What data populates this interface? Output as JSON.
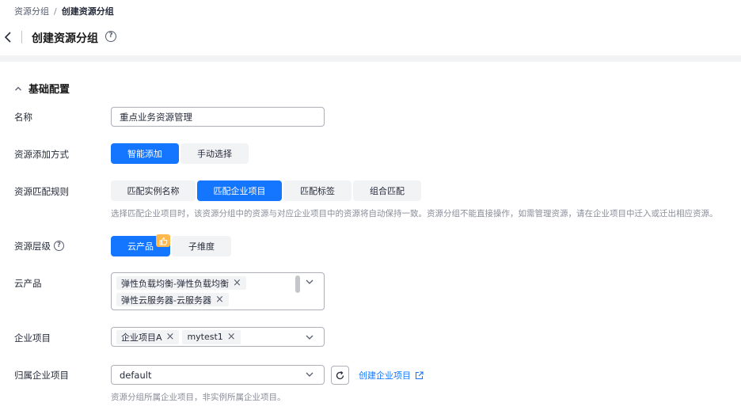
{
  "breadcrumb": {
    "parent": "资源分组",
    "separator": "/",
    "current": "创建资源分组"
  },
  "header": {
    "title": "创建资源分组",
    "help": "?"
  },
  "section": {
    "title": "基础配置"
  },
  "form": {
    "name": {
      "label": "名称",
      "value": "重点业务资源管理"
    },
    "add_mode": {
      "label": "资源添加方式",
      "options": [
        "智能添加",
        "手动选择"
      ],
      "selected": "智能添加"
    },
    "match_rule": {
      "label": "资源匹配规则",
      "options": [
        "匹配实例名称",
        "匹配企业项目",
        "匹配标签",
        "组合匹配"
      ],
      "selected": "匹配企业项目",
      "hint": "选择匹配企业项目时，该资源分组中的资源与对应企业项目中的资源将自动保持一致。资源分组不能直接操作，如需管理资源，请在企业项目中迁入或迁出相应资源。"
    },
    "level": {
      "label": "资源层级",
      "help": "?",
      "options": [
        "云产品",
        "子维度"
      ],
      "selected": "云产品"
    },
    "cloud_product": {
      "label": "云产品",
      "tags": [
        "弹性负载均衡-弹性负载均衡",
        "弹性云服务器-云服务器"
      ]
    },
    "enterprise_project": {
      "label": "企业项目",
      "tags": [
        "企业项目A",
        "mytest1"
      ]
    },
    "owner_project": {
      "label": "归属企业项目",
      "value": "default",
      "link": "创建企业项目",
      "hint": "资源分组所属企业项目，非实例所属企业项目。"
    }
  },
  "colors": {
    "primary": "#1476ff",
    "badge": "#ffb84d"
  },
  "icons": {
    "back": "chevron-left-icon",
    "collapse": "chevron-up-icon",
    "dropdown": "chevron-down-icon",
    "refresh": "refresh-icon",
    "external": "external-link-icon",
    "close": "close-icon",
    "recommend": "thumbs-up-icon"
  }
}
